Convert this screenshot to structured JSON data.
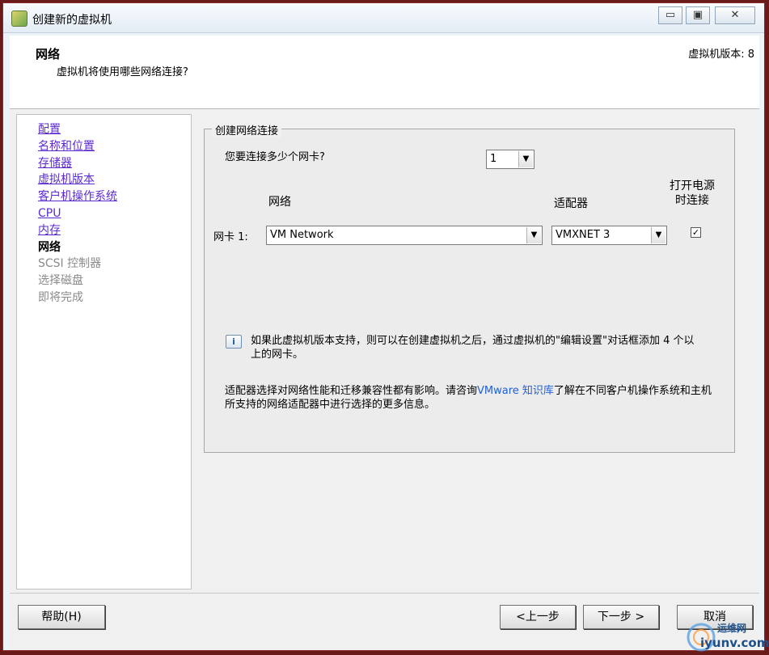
{
  "window": {
    "title": "创建新的虚拟机",
    "minimize_glyph": "▭",
    "restore_glyph": "▣",
    "close_glyph": "✕"
  },
  "header": {
    "title": "网络",
    "subtitle": "虚拟机将使用哪些网络连接?",
    "version": "虚拟机版本: 8"
  },
  "nav": {
    "items": [
      {
        "label": "配置",
        "state": "link"
      },
      {
        "label": "名称和位置",
        "state": "link"
      },
      {
        "label": "存储器",
        "state": "link"
      },
      {
        "label": "虚拟机版本",
        "state": "link"
      },
      {
        "label": "客户机操作系统",
        "state": "link"
      },
      {
        "label": "CPU",
        "state": "link"
      },
      {
        "label": "内存",
        "state": "link"
      },
      {
        "label": "网络",
        "state": "current"
      },
      {
        "label": "SCSI 控制器",
        "state": "pending"
      },
      {
        "label": "选择磁盘",
        "state": "pending"
      },
      {
        "label": "即将完成",
        "state": "pending"
      }
    ]
  },
  "group": {
    "legend": "创建网络连接",
    "question": "您要连接多少个网卡?",
    "nic_count": "1",
    "col_network": "网络",
    "col_adapter": "适配器",
    "col_power_line1": "打开电源",
    "col_power_line2": "时连接",
    "nic1_label": "网卡 1:",
    "nic1_network": "VM Network",
    "nic1_adapter": "VMXNET 3",
    "nic1_connect_checked": true,
    "check_glyph": "✓",
    "arrow_glyph": "▼",
    "info_icon_glyph": "i",
    "info_text": "如果此虚拟机版本支持，则可以在创建虚拟机之后，通过虚拟机的\"编辑设置\"对话框添加 4 个以上的网卡。",
    "adapter_text_before": "适配器选择对网络性能和迁移兼容性都有影响。请咨询",
    "adapter_link": "VMware 知识库",
    "adapter_text_after": "了解在不同客户机操作系统和主机所支持的网络适配器中进行选择的更多信息。"
  },
  "footer": {
    "help": "帮助(H)",
    "back": "<上一步",
    "next": "下一步 >",
    "cancel": "取消"
  },
  "watermark": {
    "line1": "运维网",
    "line2": "iyunv.com"
  }
}
